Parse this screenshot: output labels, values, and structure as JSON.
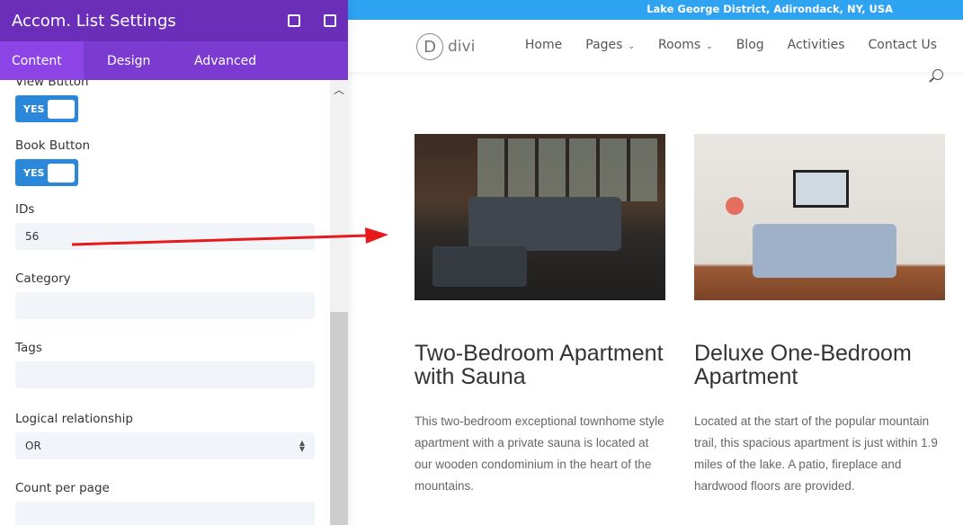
{
  "panel": {
    "title": "Accom. List Settings",
    "tabs": [
      "Content",
      "Design",
      "Advanced"
    ],
    "fields": {
      "view_button": {
        "label": "View Button",
        "value": "YES"
      },
      "book_button": {
        "label": "Book Button",
        "value": "YES"
      },
      "ids": {
        "label": "IDs",
        "value": "56"
      },
      "category": {
        "label": "Category",
        "value": ""
      },
      "tags": {
        "label": "Tags",
        "value": ""
      },
      "logical": {
        "label": "Logical relationship",
        "value": "OR"
      },
      "count": {
        "label": "Count per page",
        "value": ""
      }
    }
  },
  "site": {
    "topbar": "Lake George District, Adirondack, NY, USA",
    "logo": "divi",
    "menu": [
      "Home",
      "Pages",
      "Rooms",
      "Blog",
      "Activities",
      "Contact Us"
    ],
    "cards": [
      {
        "title": "Two-Bedroom Apartment with Sauna",
        "desc": "This two-bedroom exceptional townhome style apartment with a private sauna is located at our wooden condominium in the heart of the mountains."
      },
      {
        "title": "Deluxe One-Bedroom Apartment",
        "desc": "Located at the start of the popular mountain trail, this spacious apartment is just within 1.9 miles of the lake. A patio, fireplace and hardwood floors are provided."
      }
    ]
  },
  "colors": {
    "panel_header": "#6a2eb8",
    "tabs": "#7b3bd1",
    "toggle": "#2b87da",
    "topbar": "#2ea3f2",
    "arrow": "#e8191b"
  }
}
